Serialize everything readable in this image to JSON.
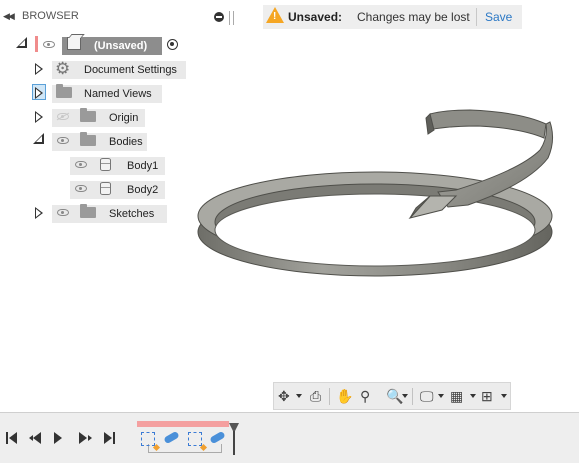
{
  "browser": {
    "title": "BROWSER",
    "root": {
      "label": "(Unsaved)"
    },
    "items": [
      {
        "name": "document-settings",
        "label": "Document Settings"
      },
      {
        "name": "named-views",
        "label": "Named Views"
      },
      {
        "name": "origin",
        "label": "Origin"
      },
      {
        "name": "bodies",
        "label": "Bodies"
      },
      {
        "name": "body1",
        "label": "Body1"
      },
      {
        "name": "body2",
        "label": "Body2"
      },
      {
        "name": "sketches",
        "label": "Sketches"
      }
    ]
  },
  "notification": {
    "title": "Unsaved:",
    "message": "Changes may be lost",
    "action": "Save"
  },
  "navigation_toolbar": {
    "tools": [
      "orbit-icon",
      "look-at-icon",
      "pan-icon",
      "zoom-icon",
      "fit-icon",
      "display-settings-icon",
      "grid-icon",
      "viewports-icon"
    ]
  },
  "timeline": {
    "features": [
      "sketch",
      "sweep",
      "sketch",
      "sweep"
    ]
  },
  "colors": {
    "accent": "#2b78c5",
    "warning": "#f5a623",
    "model": "#8c8c86",
    "active_marker": "#f08c8c"
  }
}
